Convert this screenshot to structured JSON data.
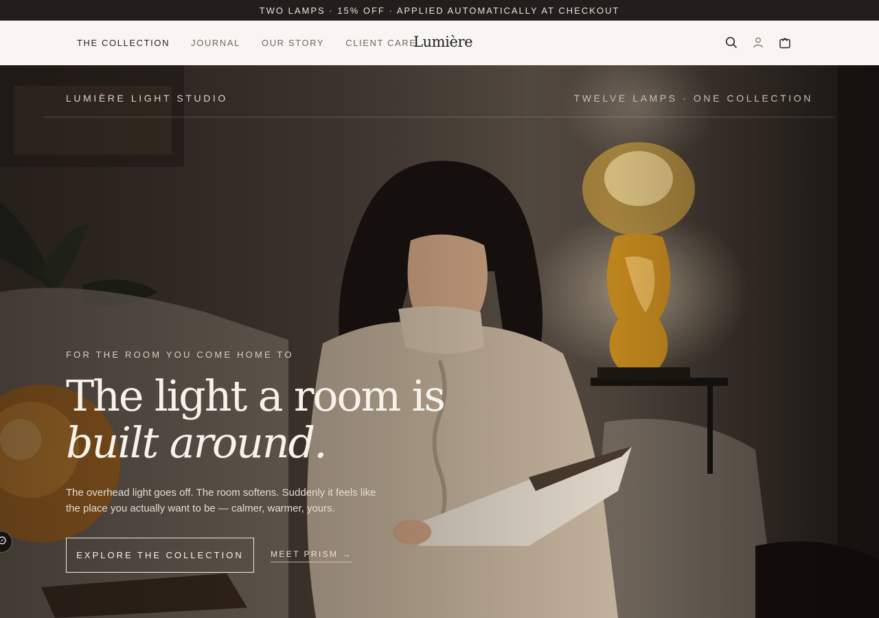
{
  "announcement": "TWO LAMPS · 15% OFF · APPLIED AUTOMATICALLY AT CHECKOUT",
  "nav": {
    "items": [
      {
        "label": "THE COLLECTION"
      },
      {
        "label": "JOURNAL"
      },
      {
        "label": "OUR STORY"
      },
      {
        "label": "CLIENT CARE"
      }
    ],
    "logo": "Lumière",
    "icons": [
      "search-icon",
      "account-icon",
      "cart-icon"
    ]
  },
  "hero": {
    "studio_left": "LUMIÈRE LIGHT STUDIO",
    "studio_right": "TWELVE LAMPS · ONE COLLECTION",
    "eyebrow": "FOR THE ROOM YOU COME HOME TO",
    "headline_line1": "The light a room is",
    "headline_line2": "built around.",
    "subtext": "The overhead light goes off. The room softens. Suddenly it feels like the place you actually want to be — calmer, warmer, yours.",
    "primary_cta": "EXPLORE THE COLLECTION",
    "secondary_cta": "MEET PRISM →"
  },
  "colors": {
    "announcement_bg": "#221e1b",
    "header_bg": "#f8f6f2",
    "hero_text": "#f7f2ea",
    "lamp_glow": "#d98a2a"
  }
}
